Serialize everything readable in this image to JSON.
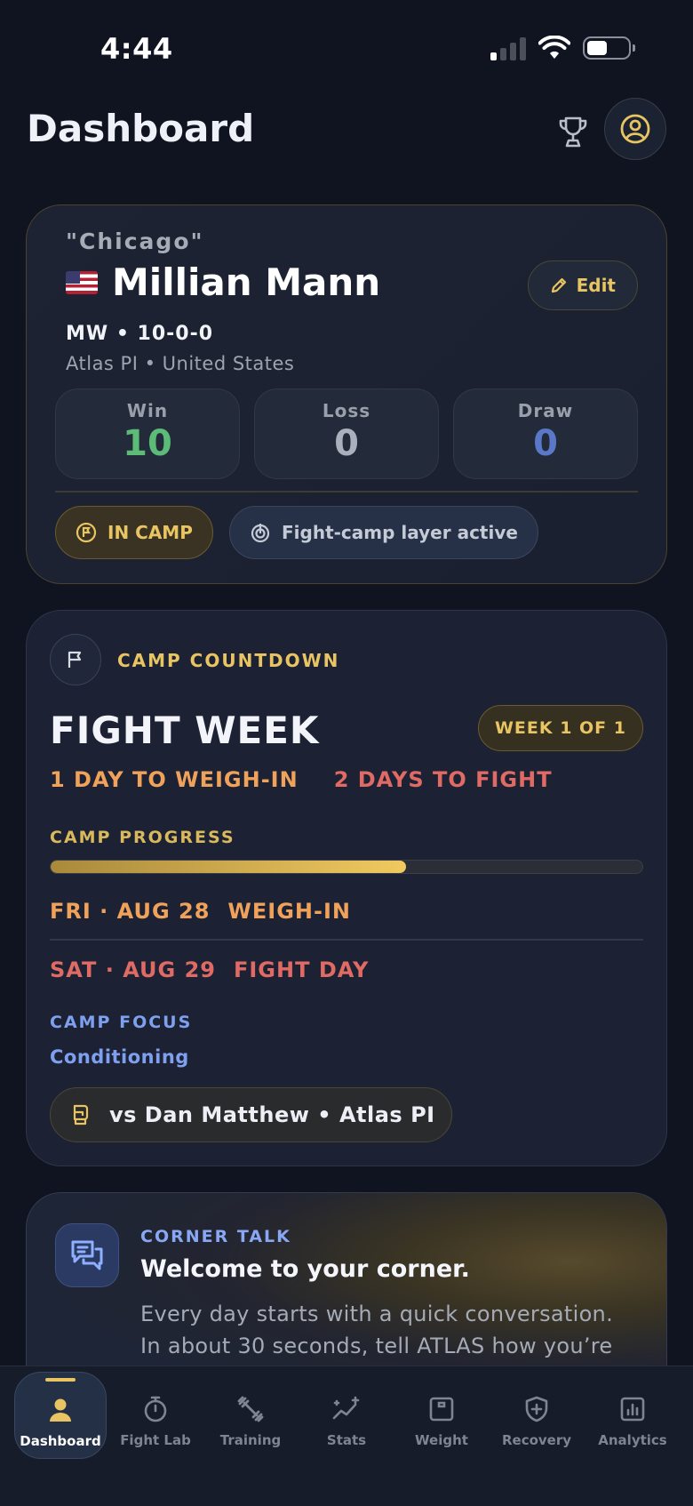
{
  "status_bar": {
    "time": "4:44"
  },
  "header": {
    "title": "Dashboard",
    "trophy_icon": "trophy-icon",
    "profile_icon": "user-circle-icon"
  },
  "profile": {
    "nickname": "\"Chicago\"",
    "flag": "us-flag",
    "name": "Millian Mann",
    "edit_label": "Edit",
    "record_line": "MW • 10-0-0",
    "affiliation": "Atlas PI • United States",
    "stats": [
      {
        "label": "Win",
        "value": "10",
        "color": "#5dbb78"
      },
      {
        "label": "Loss",
        "value": "0",
        "color": "#aab1bd"
      },
      {
        "label": "Draw",
        "value": "0",
        "color": "#5a78c8"
      }
    ],
    "camp_chip": "IN CAMP",
    "layer_chip": "Fight-camp layer active"
  },
  "countdown": {
    "kicker": "CAMP COUNTDOWN",
    "phase": "FIGHT WEEK",
    "week_badge": "WEEK 1 OF 1",
    "days_to_weigh_in": "1 DAY TO WEIGH-IN",
    "days_to_fight": "2 DAYS TO FIGHT",
    "progress_label": "CAMP PROGRESS",
    "progress_fraction": 0.6,
    "weigh_in_date": "FRI · AUG 28",
    "weigh_in_label": "WEIGH-IN",
    "fight_date": "SAT · AUG 29",
    "fight_label": "FIGHT DAY",
    "focus_label": "CAMP FOCUS",
    "focus_value": "Conditioning",
    "opponent": "vs Dan Matthew • Atlas PI"
  },
  "corner_talk": {
    "kicker": "CORNER TALK",
    "title": "Welcome to your corner.",
    "body": "Every day starts with a quick conversation. In about 30 seconds, tell ATLAS how you’re"
  },
  "tabs": [
    {
      "label": "Dashboard",
      "icon": "user-icon",
      "active": true
    },
    {
      "label": "Fight Lab",
      "icon": "stopwatch-icon",
      "active": false
    },
    {
      "label": "Training",
      "icon": "dumbbell-icon",
      "active": false
    },
    {
      "label": "Stats",
      "icon": "trend-sparkle-icon",
      "active": false
    },
    {
      "label": "Weight",
      "icon": "scale-icon",
      "active": false
    },
    {
      "label": "Recovery",
      "icon": "shield-plus-icon",
      "active": false
    },
    {
      "label": "Analytics",
      "icon": "bar-chart-icon",
      "active": false
    }
  ],
  "colors": {
    "accent_gold": "#e8c462",
    "weigh_in_orange": "#f0a15a",
    "fight_red": "#e06a64",
    "focus_blue": "#7ea0ef",
    "background": "#0f1420"
  }
}
